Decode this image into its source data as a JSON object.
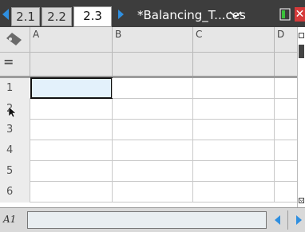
{
  "tabs": [
    {
      "label": "2.1",
      "active": false
    },
    {
      "label": "2.2",
      "active": false
    },
    {
      "label": "2.3",
      "active": true
    }
  ],
  "document": {
    "title": "*Balancing_T...ces"
  },
  "columns": [
    "A",
    "B",
    "C",
    "D"
  ],
  "formula_row_label": "=",
  "rows": [
    "1",
    "2",
    "3",
    "4",
    "5",
    "6"
  ],
  "selected_cell": "A1",
  "status": {
    "cell_ref": "A1",
    "entry_value": ""
  },
  "icons": {
    "tab_prev": "left-arrow-icon",
    "tab_next": "right-arrow-icon",
    "doc_menu": "chevron-down-icon",
    "battery": "battery-icon",
    "close": "close-icon",
    "corner": "diamond-pencil-icon",
    "cursor": "mouse-pointer-icon"
  },
  "colors": {
    "accent": "#2f8fe0",
    "titlebar": "#3d3d3d",
    "selected_fill": "#e3f1fb"
  }
}
